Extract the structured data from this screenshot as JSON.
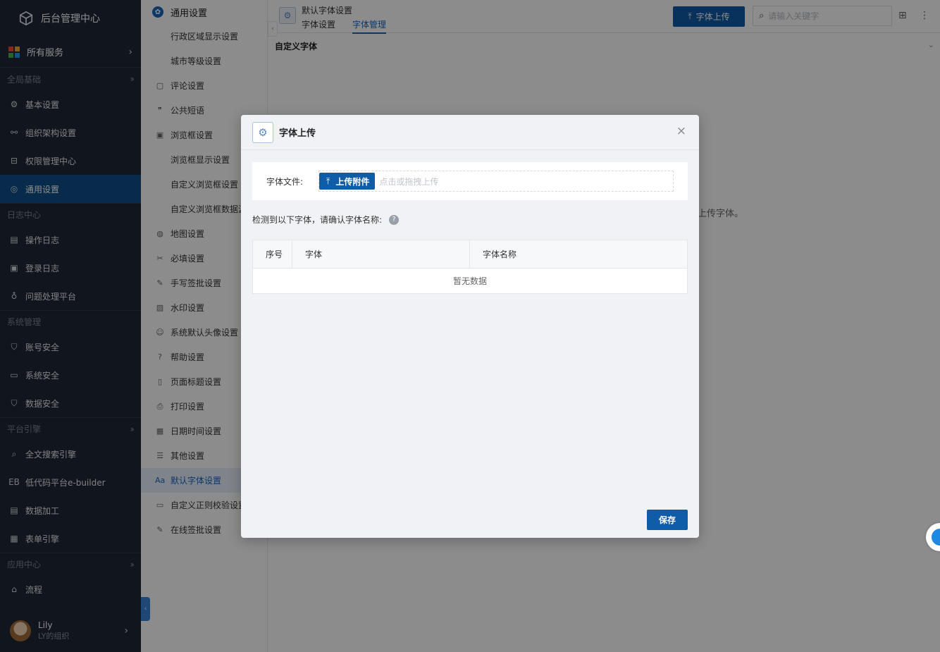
{
  "app": {
    "title": "后台管理中心"
  },
  "sidebar": {
    "all_services": "所有服务",
    "groups": [
      {
        "title": "全局基础",
        "items": [
          {
            "label": "基本设置",
            "icon": "gear-icon"
          },
          {
            "label": "组织架构设置",
            "icon": "org-icon"
          },
          {
            "label": "权限管理中心",
            "icon": "permission-icon"
          },
          {
            "label": "通用设置",
            "icon": "settings-icon",
            "active": true
          }
        ]
      },
      {
        "title": "日志中心",
        "items": [
          {
            "label": "操作日志",
            "icon": "log-icon"
          },
          {
            "label": "登录日志",
            "icon": "login-log-icon"
          },
          {
            "label": "问题处理平台",
            "icon": "planet-icon"
          }
        ]
      },
      {
        "title": "系统管理",
        "items": [
          {
            "label": "账号安全",
            "icon": "shield-icon"
          },
          {
            "label": "系统安全",
            "icon": "monitor-icon"
          },
          {
            "label": "数据安全",
            "icon": "data-shield-icon"
          }
        ]
      },
      {
        "title": "平台引擎",
        "items": [
          {
            "label": "全文搜索引擎",
            "icon": "search-icon"
          },
          {
            "label": "低代码平台e-builder",
            "icon": "eb-icon"
          },
          {
            "label": "数据加工",
            "icon": "data-process-icon"
          },
          {
            "label": "表单引擎",
            "icon": "form-icon"
          }
        ]
      },
      {
        "title": "应用中心",
        "items": [
          {
            "label": "流程",
            "icon": "flow-icon"
          }
        ]
      }
    ],
    "user": {
      "name": "Lily",
      "org": "LY的组织"
    }
  },
  "submenu": {
    "title": "通用设置",
    "items": [
      {
        "label": "行政区域显示设置",
        "child": true,
        "icon": ""
      },
      {
        "label": "城市等级设置",
        "child": true,
        "icon": ""
      },
      {
        "label": "评论设置",
        "child": false,
        "icon": "comment-icon"
      },
      {
        "label": "公共短语",
        "child": false,
        "icon": "quote-icon"
      },
      {
        "label": "浏览框设置",
        "child": false,
        "icon": "browser-icon"
      },
      {
        "label": "浏览框显示设置",
        "child": true,
        "icon": ""
      },
      {
        "label": "自定义浏览框设置",
        "child": true,
        "icon": ""
      },
      {
        "label": "自定义浏览框数据源",
        "child": true,
        "icon": ""
      },
      {
        "label": "地图设置",
        "child": false,
        "icon": "map-icon"
      },
      {
        "label": "必填设置",
        "child": false,
        "icon": "required-icon"
      },
      {
        "label": "手写签批设置",
        "child": false,
        "icon": "pen-icon"
      },
      {
        "label": "水印设置",
        "child": false,
        "icon": "watermark-icon"
      },
      {
        "label": "系统默认头像设置",
        "child": false,
        "icon": "avatar-icon"
      },
      {
        "label": "帮助设置",
        "child": false,
        "icon": "help-icon"
      },
      {
        "label": "页面标题设置",
        "child": false,
        "icon": "page-title-icon"
      },
      {
        "label": "打印设置",
        "child": false,
        "icon": "print-icon"
      },
      {
        "label": "日期时间设置",
        "child": false,
        "icon": "calendar-icon"
      },
      {
        "label": "其他设置",
        "child": false,
        "icon": "list-icon"
      },
      {
        "label": "默认字体设置",
        "child": false,
        "icon": "font-icon",
        "active": true
      },
      {
        "label": "自定义正则校验设置",
        "child": false,
        "icon": "regex-icon"
      },
      {
        "label": "在线签批设置",
        "child": false,
        "icon": "sign-icon"
      }
    ]
  },
  "main": {
    "page_title": "默认字体设置",
    "tabs": [
      {
        "label": "字体设置"
      },
      {
        "label": "字体管理",
        "active": true
      }
    ],
    "upload_button": "字体上传",
    "search_placeholder": "请输入关键字",
    "section_title": "自定义字体",
    "empty_hint": "上传字体。"
  },
  "modal": {
    "title": "字体上传",
    "file_label": "字体文件:",
    "attach_button": "上传附件",
    "drop_hint": "点击或拖拽上传",
    "detect_text": "检测到以下字体，请确认字体名称:",
    "help": "?",
    "table": {
      "columns": [
        "序号",
        "字体",
        "字体名称"
      ],
      "empty": "暂无数据"
    },
    "save_button": "保存",
    "close": "×"
  },
  "colors": {
    "primary": "#0f5ca8",
    "sidebar_bg": "#1f2937",
    "active_nav": "#0f4f89"
  }
}
